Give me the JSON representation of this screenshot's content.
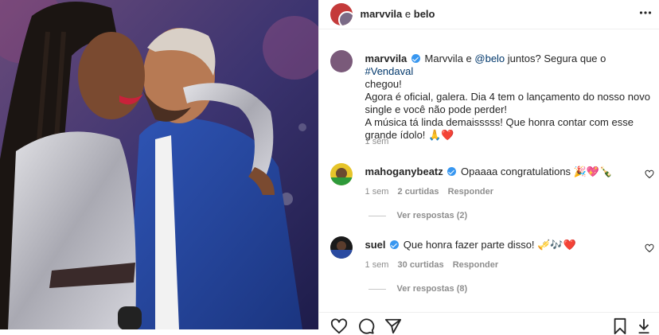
{
  "post": {
    "header_username": "marvvila",
    "header_sep": "e",
    "header_coauthor": "belo",
    "more_icon": "more-horizontal-icon"
  },
  "caption": {
    "username": "marvvila",
    "text_1": "Marvvila e ",
    "mention": "@belo",
    "text_2": " juntos? Segura que o ",
    "hashtag": "#Vendaval",
    "line_2": "chegou!",
    "line_3": "Agora é oficial, galera. Dia 4 tem o lançamento do nosso novo",
    "line_4": "single e você não pode perder!",
    "line_5": "A música tá linda demaisssss! Que honra contar com esse",
    "line_6": "grande ídolo! 🙏❤️",
    "time": "1 sem"
  },
  "comments": [
    {
      "username": "mahoganybeatz",
      "text": "Opaaaa congratulations 🎉💖🍾",
      "time": "1 sem",
      "likes": "2 curtidas",
      "reply": "Responder",
      "view_replies": "Ver respostas (2)"
    },
    {
      "username": "suel",
      "text": "Que honra fazer parte disso! 🎺🎶❤️",
      "time": "1 sem",
      "likes": "30 curtidas",
      "reply": "Responder",
      "view_replies": "Ver respostas (8)"
    }
  ],
  "colors": {
    "verified": "#3897f0",
    "link": "#00376b",
    "meta": "#8e8e8e"
  }
}
